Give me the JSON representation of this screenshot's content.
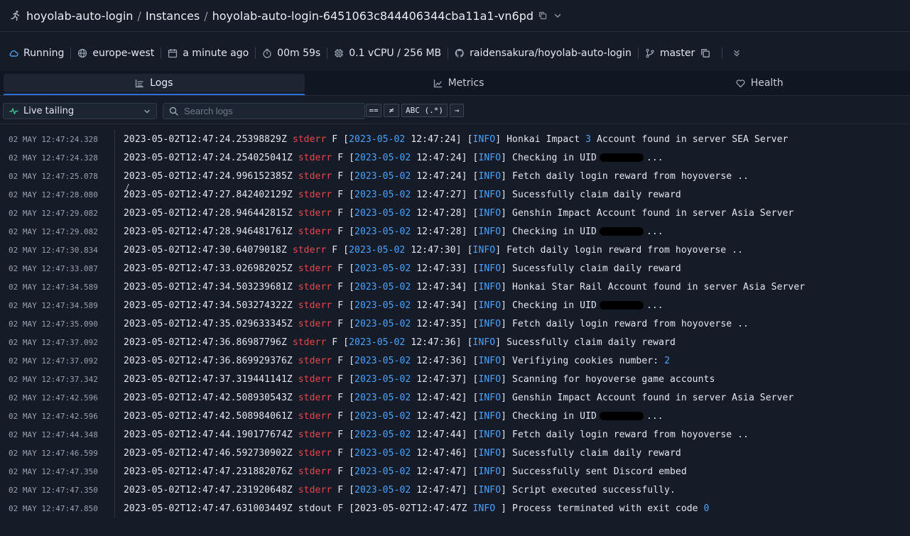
{
  "breadcrumb": {
    "project": "hoyolab-auto-login",
    "section": "Instances",
    "instance": "hoyolab-auto-login-6451063c844406344cba11a1-vn6pd",
    "separator": "/"
  },
  "status": {
    "state": "Running",
    "region": "europe-west",
    "created": "a minute ago",
    "uptime": "00m 59s",
    "resources": "0.1 vCPU / 256 MB",
    "repo": "raidensakura/hoyolab-auto-login",
    "branch": "master"
  },
  "tabs": [
    {
      "label": "Logs",
      "icon": "list-icon",
      "active": true
    },
    {
      "label": "Metrics",
      "icon": "chart-icon",
      "active": false
    },
    {
      "label": "Health",
      "icon": "heart-icon",
      "active": false
    }
  ],
  "filters": {
    "mode": "Live tailing",
    "search_placeholder": "Search logs",
    "eq_label": "==",
    "neq_label": "≠",
    "regex_label": "ABC (.*)",
    "go_label": "→"
  },
  "colors": {
    "accent": "#2b6fd6",
    "stderr": "#e5484d",
    "info": "#4aa3ff",
    "running": "#4a9eea",
    "live": "#34c38f"
  },
  "logs": [
    {
      "time": "02 MAY 12:47:24.328",
      "iso": "2023-05-02T12:47:24.25398829Z",
      "stream": "stderr",
      "date": "2023-05-02",
      "clock": "12:47:24",
      "level": "INFO",
      "game": "Honkai Impact",
      "game_num": "3",
      "msg": "Account found in server SEA Server"
    },
    {
      "time": "02 MAY 12:47:24.328",
      "iso": "2023-05-02T12:47:24.254025041Z",
      "stream": "stderr",
      "date": "2023-05-02",
      "clock": "12:47:24",
      "level": "INFO",
      "msg": "Checking in UID",
      "uid_suffix": "..."
    },
    {
      "time": "02 MAY 12:47:25.078",
      "iso": "2023-05-02T12:47:24.996152385Z",
      "stream": "stderr",
      "date": "2023-05-02",
      "clock": "12:47:24",
      "level": "INFO",
      "msg": "Fetch daily login reward from hoyoverse .."
    },
    {
      "time": "02 MAY 12:47:28.080",
      "iso": "2023-05-02T12:47:27.842402129Z",
      "stream": "stderr",
      "date": "2023-05-02",
      "clock": "12:47:27",
      "level": "INFO",
      "msg": "Sucessfully claim daily reward"
    },
    {
      "time": "02 MAY 12:47:29.082",
      "iso": "2023-05-02T12:47:28.946442815Z",
      "stream": "stderr",
      "date": "2023-05-02",
      "clock": "12:47:28",
      "level": "INFO",
      "msg": "Genshin Impact Account found in server Asia Server"
    },
    {
      "time": "02 MAY 12:47:29.082",
      "iso": "2023-05-02T12:47:28.946481761Z",
      "stream": "stderr",
      "date": "2023-05-02",
      "clock": "12:47:28",
      "level": "INFO",
      "msg": "Checking in UID",
      "uid_suffix": "..."
    },
    {
      "time": "02 MAY 12:47:30.834",
      "iso": "2023-05-02T12:47:30.64079018Z",
      "stream": "stderr",
      "date": "2023-05-02",
      "clock": "12:47:30",
      "level": "INFO",
      "msg": "Fetch daily login reward from hoyoverse .."
    },
    {
      "time": "02 MAY 12:47:33.087",
      "iso": "2023-05-02T12:47:33.026982025Z",
      "stream": "stderr",
      "date": "2023-05-02",
      "clock": "12:47:33",
      "level": "INFO",
      "msg": "Sucessfully claim daily reward"
    },
    {
      "time": "02 MAY 12:47:34.589",
      "iso": "2023-05-02T12:47:34.503239681Z",
      "stream": "stderr",
      "date": "2023-05-02",
      "clock": "12:47:34",
      "level": "INFO",
      "msg": "Honkai Star Rail Account found in server Asia Server"
    },
    {
      "time": "02 MAY 12:47:34.589",
      "iso": "2023-05-02T12:47:34.503274322Z",
      "stream": "stderr",
      "date": "2023-05-02",
      "clock": "12:47:34",
      "level": "INFO",
      "msg": "Checking in UID",
      "uid_suffix": "..."
    },
    {
      "time": "02 MAY 12:47:35.090",
      "iso": "2023-05-02T12:47:35.029633345Z",
      "stream": "stderr",
      "date": "2023-05-02",
      "clock": "12:47:35",
      "level": "INFO",
      "msg": "Fetch daily login reward from hoyoverse .."
    },
    {
      "time": "02 MAY 12:47:37.092",
      "iso": "2023-05-02T12:47:36.86987796Z",
      "stream": "stderr",
      "date": "2023-05-02",
      "clock": "12:47:36",
      "level": "INFO",
      "msg": "Sucessfully claim daily reward"
    },
    {
      "time": "02 MAY 12:47:37.092",
      "iso": "2023-05-02T12:47:36.869929376Z",
      "stream": "stderr",
      "date": "2023-05-02",
      "clock": "12:47:36",
      "level": "INFO",
      "msg": "Verifiying cookies number:",
      "msg_num": "2"
    },
    {
      "time": "02 MAY 12:47:37.342",
      "iso": "2023-05-02T12:47:37.319441141Z",
      "stream": "stderr",
      "date": "2023-05-02",
      "clock": "12:47:37",
      "level": "INFO",
      "msg": "Scanning for hoyoverse game accounts"
    },
    {
      "time": "02 MAY 12:47:42.596",
      "iso": "2023-05-02T12:47:42.508930543Z",
      "stream": "stderr",
      "date": "2023-05-02",
      "clock": "12:47:42",
      "level": "INFO",
      "msg": "Genshin Impact Account found in server Asia Server"
    },
    {
      "time": "02 MAY 12:47:42.596",
      "iso": "2023-05-02T12:47:42.508984061Z",
      "stream": "stderr",
      "date": "2023-05-02",
      "clock": "12:47:42",
      "level": "INFO",
      "msg": "Checking in UID",
      "uid_suffix": "..."
    },
    {
      "time": "02 MAY 12:47:44.348",
      "iso": "2023-05-02T12:47:44.190177674Z",
      "stream": "stderr",
      "date": "2023-05-02",
      "clock": "12:47:44",
      "level": "INFO",
      "msg": "Fetch daily login reward from hoyoverse .."
    },
    {
      "time": "02 MAY 12:47:46.599",
      "iso": "2023-05-02T12:47:46.592730902Z",
      "stream": "stderr",
      "date": "2023-05-02",
      "clock": "12:47:46",
      "level": "INFO",
      "msg": "Sucessfully claim daily reward"
    },
    {
      "time": "02 MAY 12:47:47.350",
      "iso": "2023-05-02T12:47:47.231882076Z",
      "stream": "stderr",
      "date": "2023-05-02",
      "clock": "12:47:47",
      "level": "INFO",
      "msg": "Successfully sent Discord embed"
    },
    {
      "time": "02 MAY 12:47:47.350",
      "iso": "2023-05-02T12:47:47.231920648Z",
      "stream": "stderr",
      "date": "2023-05-02",
      "clock": "12:47:47",
      "level": "INFO",
      "msg": "Script executed successfully."
    },
    {
      "time": "02 MAY 12:47:47.850",
      "iso": "2023-05-02T12:47:47.631003449Z",
      "stream": "stdout",
      "terminal": true,
      "stamp": "2023-05-02T12:47:47Z",
      "level": "INFO",
      "msg": "Process terminated with exit code",
      "msg_num": "0"
    }
  ]
}
